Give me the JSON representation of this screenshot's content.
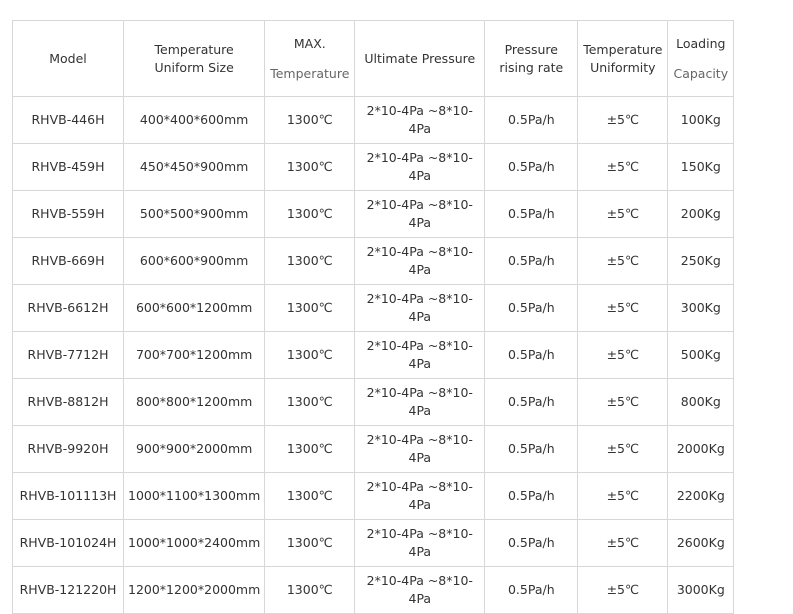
{
  "table": {
    "headers": {
      "model": "Model",
      "size_l1": "Temperature",
      "size_l2": "Uniform Size",
      "max_l1": "MAX.",
      "max_l2": "Temperature",
      "pressure": "Ultimate Pressure",
      "rising_l1": "Pressure",
      "rising_l2": "rising rate",
      "unif_l1": "Temperature",
      "unif_l2": "Uniformity",
      "load_l1": "Loading",
      "load_l2": "Capacity"
    },
    "rows": [
      {
        "model": "RHVB-446H",
        "size": "400*400*600mm",
        "max_temp": "1300℃",
        "pressure_l1": "2*10-4Pa ~8*10-",
        "pressure_l2": "4Pa",
        "rising_rate": "0.5Pa/h",
        "uniformity": "±5℃",
        "capacity": "100Kg"
      },
      {
        "model": "RHVB-459H",
        "size": "450*450*900mm",
        "max_temp": "1300℃",
        "pressure_l1": "2*10-4Pa ~8*10-",
        "pressure_l2": "4Pa",
        "rising_rate": "0.5Pa/h",
        "uniformity": "±5℃",
        "capacity": "150Kg"
      },
      {
        "model": "RHVB-559H",
        "size": "500*500*900mm",
        "max_temp": "1300℃",
        "pressure_l1": "2*10-4Pa ~8*10-",
        "pressure_l2": "4Pa",
        "rising_rate": "0.5Pa/h",
        "uniformity": "±5℃",
        "capacity": "200Kg"
      },
      {
        "model": "RHVB-669H",
        "size": "600*600*900mm",
        "max_temp": "1300℃",
        "pressure_l1": "2*10-4Pa ~8*10-",
        "pressure_l2": "4Pa",
        "rising_rate": "0.5Pa/h",
        "uniformity": "±5℃",
        "capacity": "250Kg"
      },
      {
        "model": "RHVB-6612H",
        "size": "600*600*1200mm",
        "max_temp": "1300℃",
        "pressure_l1": "2*10-4Pa ~8*10-",
        "pressure_l2": "4Pa",
        "rising_rate": "0.5Pa/h",
        "uniformity": "±5℃",
        "capacity": "300Kg"
      },
      {
        "model": "RHVB-7712H",
        "size": "700*700*1200mm",
        "max_temp": "1300℃",
        "pressure_l1": "2*10-4Pa ~8*10-",
        "pressure_l2": "4Pa",
        "rising_rate": "0.5Pa/h",
        "uniformity": "±5℃",
        "capacity": "500Kg"
      },
      {
        "model": "RHVB-8812H",
        "size": "800*800*1200mm",
        "max_temp": "1300℃",
        "pressure_l1": "2*10-4Pa ~8*10-",
        "pressure_l2": "4Pa",
        "rising_rate": "0.5Pa/h",
        "uniformity": "±5℃",
        "capacity": "800Kg"
      },
      {
        "model": "RHVB-9920H",
        "size": "900*900*2000mm",
        "max_temp": "1300℃",
        "pressure_l1": "2*10-4Pa ~8*10-",
        "pressure_l2": "4Pa",
        "rising_rate": "0.5Pa/h",
        "uniformity": "±5℃",
        "capacity": "2000Kg"
      },
      {
        "model": "RHVB-101113H",
        "size": "1000*1100*1300mm",
        "max_temp": "1300℃",
        "pressure_l1": "2*10-4Pa ~8*10-",
        "pressure_l2": "4Pa",
        "rising_rate": "0.5Pa/h",
        "uniformity": "±5℃",
        "capacity": "2200Kg"
      },
      {
        "model": "RHVB-101024H",
        "size": "1000*1000*2400mm",
        "max_temp": "1300℃",
        "pressure_l1": "2*10-4Pa ~8*10-",
        "pressure_l2": "4Pa",
        "rising_rate": "0.5Pa/h",
        "uniformity": "±5℃",
        "capacity": "2600Kg"
      },
      {
        "model": "RHVB-121220H",
        "size": "1200*1200*2000mm",
        "max_temp": "1300℃",
        "pressure_l1": "2*10-4Pa ~8*10-",
        "pressure_l2": "4Pa",
        "rising_rate": "0.5Pa/h",
        "uniformity": "±5℃",
        "capacity": "3000Kg"
      }
    ]
  }
}
